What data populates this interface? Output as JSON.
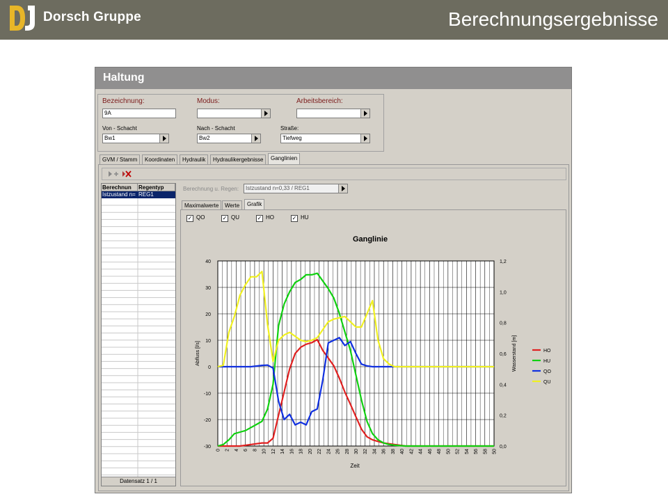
{
  "header": {
    "brand": "Dorsch Gruppe",
    "title": "Berechnungsergebnisse",
    "logo_colors": [
      "#e8b628",
      "#ffffff"
    ]
  },
  "window": {
    "title": "Haltung"
  },
  "form": {
    "bezeichnung_label": "Bezeichnung:",
    "bezeichnung_value": "9A",
    "modus_label": "Modus:",
    "modus_value": "",
    "arbeitsbereich_label": "Arbeitsbereich:",
    "arbeitsbereich_value": "",
    "von_label": "Von - Schacht",
    "von_value": "Bw1",
    "nach_label": "Nach - Schacht",
    "nach_value": "Bw2",
    "strasse_label": "Straße:",
    "strasse_value": "Tiefweg"
  },
  "tabs": [
    {
      "label": "GVM / Stamm"
    },
    {
      "label": "Koordinaten"
    },
    {
      "label": "Hydraulik"
    },
    {
      "label": "Hydraulikergebnisse"
    },
    {
      "label": "Ganglinien",
      "active": true
    }
  ],
  "toolbar": {
    "add_icon": "add-row-icon",
    "delete_icon": "delete-row-icon"
  },
  "grid": {
    "columns": [
      "Berechnun",
      "Regentyp"
    ],
    "row": {
      "berechnung": "Istzustand n=",
      "regentyp": "REG1"
    },
    "footer": "Datensatz 1 / 1"
  },
  "calc": {
    "label": "Berechnung u. Regen:",
    "value": "Istzustand n=0,33 / REG1"
  },
  "subtabs": [
    {
      "label": "Maximalwerte"
    },
    {
      "label": "Werte"
    },
    {
      "label": "Grafik",
      "active": true
    }
  ],
  "checkboxes": [
    {
      "label": "QO",
      "checked": true
    },
    {
      "label": "QU",
      "checked": true
    },
    {
      "label": "HO",
      "checked": true
    },
    {
      "label": "HU",
      "checked": true
    }
  ],
  "chart_data": {
    "type": "line",
    "title": "Ganglinie",
    "xlabel": "Zeit",
    "ylabel": "Abfluss [l/s]",
    "y2label": "Wasserstand [m]",
    "xlim": [
      0,
      50
    ],
    "ylim": [
      -30,
      40
    ],
    "y2lim": [
      0,
      1.2
    ],
    "xticks": [
      "0",
      "2",
      "4",
      "6",
      "8",
      "10",
      "12",
      "14",
      "16",
      "18",
      "20",
      "22",
      "24",
      "26",
      "28",
      "30",
      "32",
      "34",
      "36",
      "38",
      "40",
      "42",
      "44",
      "46",
      "48",
      "50",
      "52",
      "54",
      "56",
      "58",
      "50"
    ],
    "yticks": [
      "-30",
      "-20",
      "-10",
      "0",
      "10",
      "20",
      "30",
      "40"
    ],
    "y2ticks": [
      "0,0",
      "0,2",
      "0,4",
      "0,6",
      "0,8",
      "1,0",
      "1,2"
    ],
    "grid": true,
    "legend_position": "right",
    "series": [
      {
        "name": "HO",
        "axis": "right",
        "color": "#e02020",
        "x": [
          0,
          2,
          4,
          6,
          8,
          9,
          10,
          11,
          12,
          13,
          14,
          15,
          16,
          17,
          18,
          19,
          20,
          21,
          22,
          23,
          24,
          25,
          26,
          27,
          28,
          29,
          30,
          32,
          34,
          50
        ],
        "y": [
          0.0,
          0.0,
          0.0,
          0.01,
          0.02,
          0.02,
          0.05,
          0.2,
          0.35,
          0.5,
          0.6,
          0.64,
          0.66,
          0.67,
          0.69,
          0.62,
          0.57,
          0.52,
          0.44,
          0.35,
          0.27,
          0.19,
          0.11,
          0.06,
          0.04,
          0.03,
          0.02,
          0.01,
          0.0,
          0.0
        ]
      },
      {
        "name": "HU",
        "axis": "right",
        "color": "#10d010",
        "x": [
          0,
          1,
          2,
          3,
          4,
          5,
          6,
          7,
          8,
          9,
          10,
          11,
          12,
          13,
          14,
          15,
          16,
          17,
          18,
          19,
          20,
          21,
          22,
          23,
          24,
          25,
          26,
          27,
          28,
          29,
          30,
          31,
          32,
          34,
          36,
          50
        ],
        "y": [
          0.0,
          0.01,
          0.04,
          0.08,
          0.09,
          0.1,
          0.12,
          0.14,
          0.16,
          0.24,
          0.4,
          0.78,
          0.92,
          1.0,
          1.06,
          1.08,
          1.11,
          1.11,
          1.12,
          1.07,
          1.02,
          0.96,
          0.86,
          0.74,
          0.62,
          0.46,
          0.3,
          0.16,
          0.08,
          0.04,
          0.02,
          0.01,
          0.005,
          0.0,
          0.0,
          0.0
        ]
      },
      {
        "name": "QO",
        "axis": "left",
        "color": "#1030e0",
        "x": [
          0,
          2,
          4,
          6,
          8,
          9,
          10,
          11,
          12,
          13,
          14,
          15,
          16,
          17,
          18,
          19,
          20,
          21,
          22,
          23,
          24,
          25,
          26,
          27,
          28,
          30,
          32,
          34,
          36,
          50
        ],
        "y": [
          0,
          0,
          0,
          0,
          0.5,
          0.6,
          -0.5,
          -13,
          -20,
          -18,
          -22,
          -21,
          -22,
          -17,
          -16,
          -5,
          9,
          10,
          11,
          8,
          9.5,
          5,
          1,
          0.3,
          0,
          0,
          0,
          0,
          0,
          0
        ]
      },
      {
        "name": "QU",
        "axis": "left",
        "color": "#f0f020",
        "x": [
          0,
          1,
          2,
          3,
          4,
          5,
          6,
          7,
          8,
          9,
          10,
          11,
          12,
          13,
          14,
          15,
          16,
          17,
          18,
          19,
          20,
          21,
          22,
          23,
          24,
          25,
          26,
          27,
          28,
          29,
          30,
          31,
          32,
          33,
          34,
          36,
          50
        ],
        "y": [
          0,
          0.5,
          13,
          19,
          27,
          31,
          34,
          34,
          36,
          16,
          2,
          10,
          12,
          13,
          11.5,
          10,
          9.5,
          10,
          11,
          14,
          17,
          18,
          18.5,
          19,
          17,
          15,
          15,
          20,
          25,
          10,
          3,
          1,
          0,
          0,
          0,
          0,
          0
        ]
      }
    ]
  }
}
